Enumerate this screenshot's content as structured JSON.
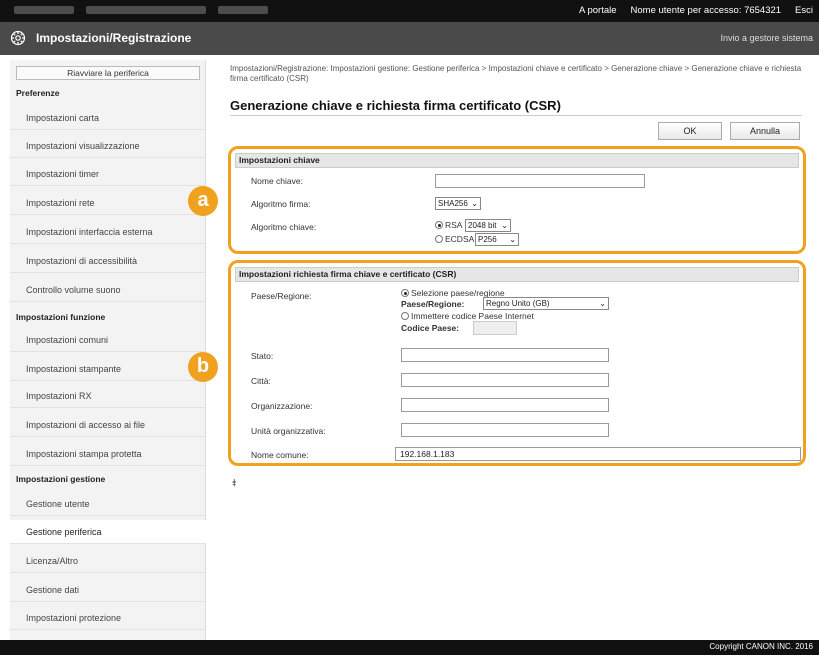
{
  "topbar": {
    "portal_link": "A portale",
    "user_label": "Nome utente per accesso:",
    "user_value": "7654321",
    "logout": "Esci"
  },
  "header": {
    "title": "Impostazioni/Registrazione",
    "goto_admin": "Invio a gestore sistema"
  },
  "sidebar": {
    "restart_button": "Riavviare la periferica",
    "section_preferences": "Preferenze",
    "preferences": [
      "Impostazioni carta",
      "Impostazioni visualizzazione",
      "Impostazioni timer",
      "Impostazioni rete",
      "Impostazioni interfaccia esterna",
      "Impostazioni di accessibilità",
      "Controllo volume suono"
    ],
    "section_function": "Impostazioni funzione",
    "functions": [
      "Impostazioni comuni",
      "Impostazioni stampante",
      "Impostazioni RX",
      "Impostazioni di accesso ai file",
      "Impostazioni stampa protetta"
    ],
    "section_management": "Impostazioni gestione",
    "management": [
      "Gestione utente",
      "Gestione periferica",
      "Licenza/Altro",
      "Gestione dati",
      "Impostazioni protezione"
    ]
  },
  "main": {
    "breadcrumb": "Impostazioni/Registrazione: Impostazioni gestione: Gestione periferica > Impostazioni chiave e certificato > Generazione chiave > Generazione chiave e richiesta firma certificato (CSR)",
    "page_title": "Generazione chiave e richiesta firma certificato (CSR)",
    "ok_button": "OK",
    "cancel_button": "Annulla",
    "key_settings": {
      "heading": "Impostazioni chiave",
      "key_name_label": "Nome chiave:",
      "key_name_value": "",
      "sig_alg_label": "Algoritmo firma:",
      "sig_alg_value": "SHA256",
      "key_alg_label": "Algoritmo chiave:",
      "rsa_label": "RSA",
      "rsa_bits": "2048 bit",
      "ecdsa_label": "ECDSA",
      "ecdsa_curve": "P256"
    },
    "csr_settings": {
      "heading": "Impostazioni richiesta firma chiave e certificato (CSR)",
      "country_label": "Paese/Regione:",
      "select_country_option": "Selezione paese/regione",
      "country_sub_label": "Paese/Regione:",
      "country_value": "Regno Unito (GB)",
      "enter_code_option": "Immettere codice Paese Internet",
      "country_code_label": "Codice Paese:",
      "state_label": "Stato:",
      "city_label": "Città:",
      "org_label": "Organizzazione:",
      "org_unit_label": "Unità organizzativa:",
      "common_name_label": "Nome comune:",
      "common_name_value": "192.168.1.183"
    },
    "badge_a": "a",
    "badge_b": "b",
    "to_top": "⯒"
  },
  "footer": {
    "copyright": "Copyright CANON INC. 2016"
  },
  "colors": {
    "accent": "#f0a21f",
    "topbar": "#111111",
    "titlebar": "#4a4a4a"
  }
}
